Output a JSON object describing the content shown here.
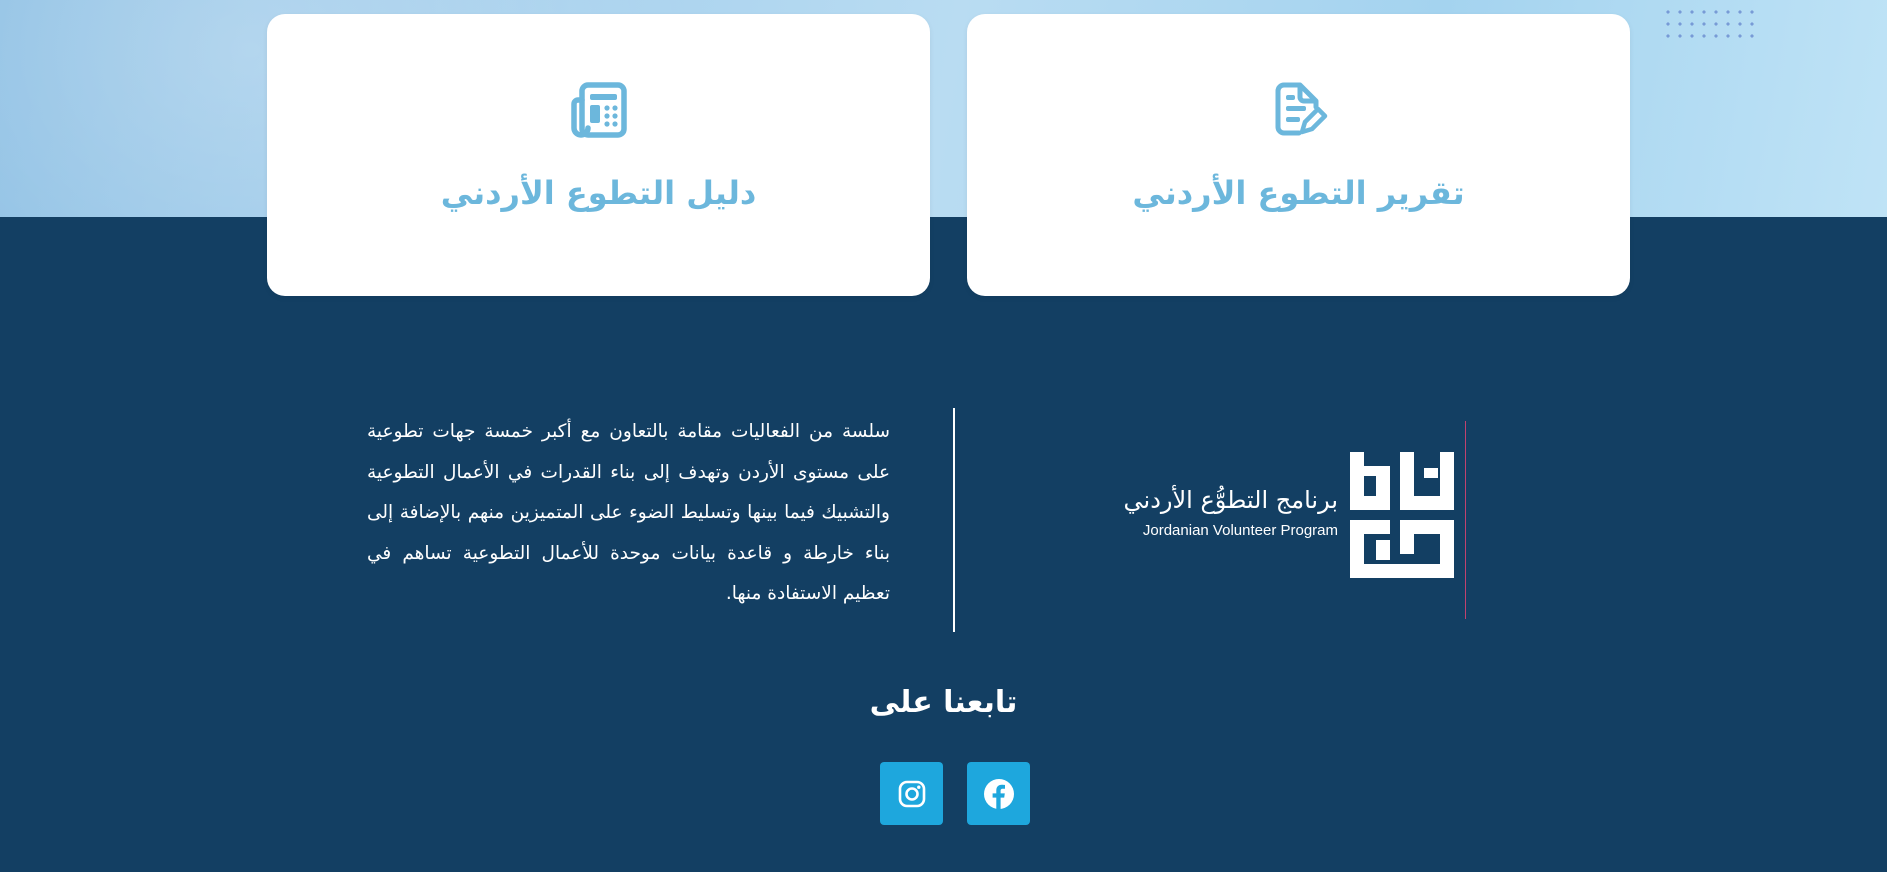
{
  "colors": {
    "accent": "#6cb7dc",
    "footer_bg": "#133f63",
    "social_bg": "#1ea7dd"
  },
  "cards": [
    {
      "title": "دليل التطوع الأردني",
      "icon": "newspaper-icon"
    },
    {
      "title": "تقرير التطوع الأردني",
      "icon": "file-pen-icon"
    }
  ],
  "logo": {
    "arabic": "برنامج التطوُّع الأردني",
    "english": "Jordanian Volunteer Program"
  },
  "about": {
    "text": "سلسة من الفعاليات مقامة بالتعاون مع أكبر خمسة جهات تطوعية على مستوى الأردن وتهدف إلى بناء القدرات في الأعمال التطوعية والتشبيك فيما بينها وتسليط الضوء على المتميزين منهم بالإضافة إلى بناء خارطة و قاعدة بيانات موحدة للأعمال التطوعية تساهم في تعظيم الاستفادة منها."
  },
  "follow": {
    "title": "تابعنا على",
    "links": [
      {
        "icon": "instagram-icon"
      },
      {
        "icon": "facebook-icon"
      }
    ]
  }
}
